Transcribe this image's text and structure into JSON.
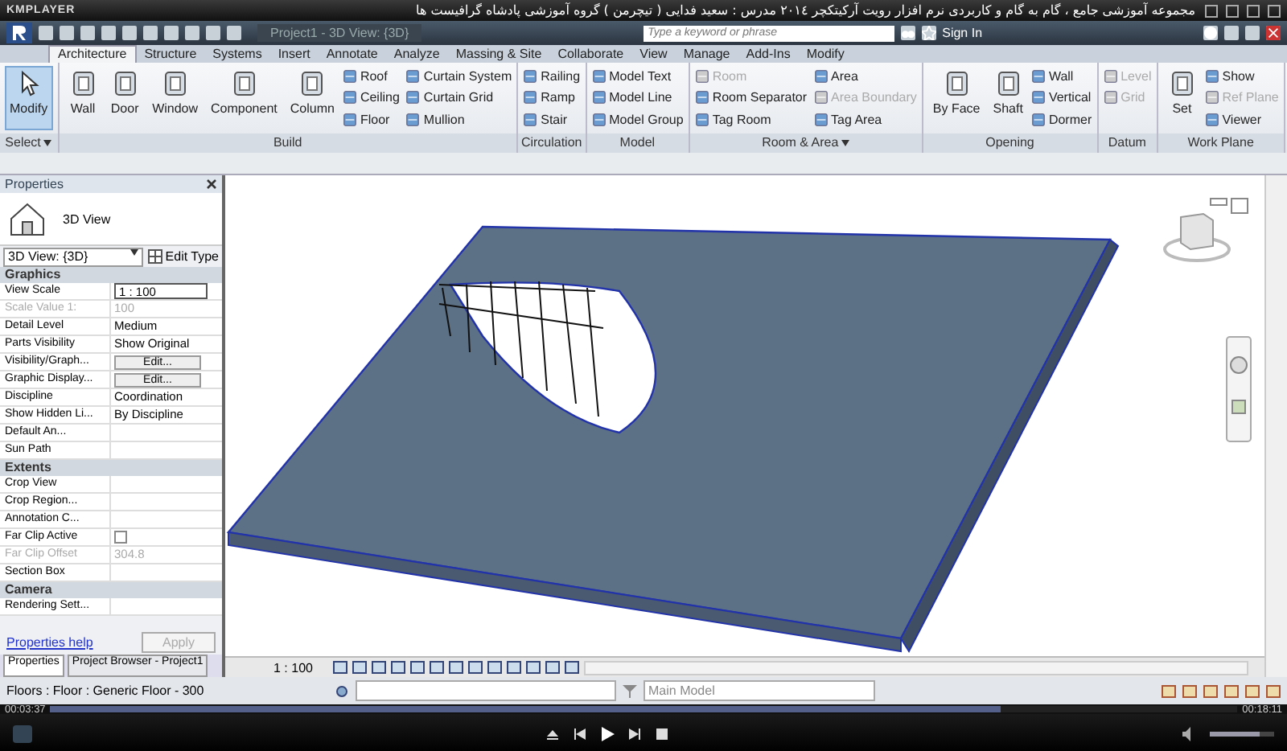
{
  "player": {
    "logo": "KMPLAYER",
    "title": "مجموعه آموزشی جامع ، گام به گام و کاربردی نرم افزار رویت آرکیتکچر ٢٠١٤   مدرس : سعید فدایی ( تیچرمن ) گروه آموزشی پادشاه گرافیست ها"
  },
  "revit": {
    "document_title": "Project1 - 3D View: {3D}",
    "search": {
      "placeholder": "Type a keyword or phrase"
    },
    "sign_in": "Sign In",
    "tabs": [
      {
        "label": "Architecture",
        "selected": true
      },
      {
        "label": "Structure",
        "selected": false
      },
      {
        "label": "Systems",
        "selected": false
      },
      {
        "label": "Insert",
        "selected": false
      },
      {
        "label": "Annotate",
        "selected": false
      },
      {
        "label": "Analyze",
        "selected": false
      },
      {
        "label": "Massing & Site",
        "selected": false
      },
      {
        "label": "Collaborate",
        "selected": false
      },
      {
        "label": "View",
        "selected": false
      },
      {
        "label": "Manage",
        "selected": false
      },
      {
        "label": "Add-Ins",
        "selected": false
      },
      {
        "label": "Modify",
        "selected": false
      }
    ],
    "panels": [
      {
        "label": "Select",
        "dropdown": true,
        "tools": [
          {
            "label": "Modify",
            "kind": "large",
            "disabled": false,
            "selected": true
          }
        ]
      },
      {
        "label": "Build",
        "tools": [
          {
            "label": "Wall",
            "kind": "large",
            "disabled": false,
            "selected": false
          },
          {
            "label": "Door",
            "kind": "large",
            "disabled": false,
            "selected": false
          },
          {
            "label": "Window",
            "kind": "large",
            "disabled": false,
            "selected": false
          },
          {
            "label": "Component",
            "kind": "large",
            "disabled": false,
            "selected": false
          },
          {
            "label": "Column",
            "kind": "large",
            "disabled": false,
            "selected": false
          },
          {
            "label": "Roof",
            "kind": "small",
            "disabled": false,
            "selected": false
          },
          {
            "label": "Ceiling",
            "kind": "small",
            "disabled": false,
            "selected": false
          },
          {
            "label": "Floor",
            "kind": "small",
            "disabled": false,
            "selected": false
          },
          {
            "label": "Curtain System",
            "kind": "small",
            "disabled": false,
            "selected": false
          },
          {
            "label": "Curtain Grid",
            "kind": "small",
            "disabled": false,
            "selected": false
          },
          {
            "label": "Mullion",
            "kind": "small",
            "disabled": false,
            "selected": false
          }
        ]
      },
      {
        "label": "Circulation",
        "tools": [
          {
            "label": "Railing",
            "kind": "small",
            "disabled": false,
            "selected": false
          },
          {
            "label": "Ramp",
            "kind": "small",
            "disabled": false,
            "selected": false
          },
          {
            "label": "Stair",
            "kind": "small",
            "disabled": false,
            "selected": false
          }
        ]
      },
      {
        "label": "Model",
        "tools": [
          {
            "label": "Model Text",
            "kind": "small",
            "disabled": false,
            "selected": false
          },
          {
            "label": "Model Line",
            "kind": "small",
            "disabled": false,
            "selected": false
          },
          {
            "label": "Model Group",
            "kind": "small",
            "disabled": false,
            "selected": false
          }
        ]
      },
      {
        "label": "Room & Area",
        "dropdown": true,
        "tools": [
          {
            "label": "Room",
            "kind": "small",
            "disabled": true,
            "selected": false
          },
          {
            "label": "Room Separator",
            "kind": "small",
            "disabled": false,
            "selected": false
          },
          {
            "label": "Tag Room",
            "kind": "small",
            "disabled": false,
            "selected": false
          },
          {
            "label": "Area",
            "kind": "small",
            "disabled": false,
            "selected": false
          },
          {
            "label": "Area Boundary",
            "kind": "small",
            "disabled": true,
            "selected": false
          },
          {
            "label": "Tag Area",
            "kind": "small",
            "disabled": false,
            "selected": false
          }
        ]
      },
      {
        "label": "Opening",
        "tools": [
          {
            "label": "By Face",
            "kind": "large",
            "disabled": false,
            "selected": false
          },
          {
            "label": "Shaft",
            "kind": "large",
            "disabled": false,
            "selected": false
          },
          {
            "label": "Wall",
            "kind": "small",
            "disabled": false,
            "selected": false
          },
          {
            "label": "Vertical",
            "kind": "small",
            "disabled": false,
            "selected": false
          },
          {
            "label": "Dormer",
            "kind": "small",
            "disabled": false,
            "selected": false
          }
        ]
      },
      {
        "label": "Datum",
        "tools": [
          {
            "label": "Level",
            "kind": "small",
            "disabled": true,
            "selected": false
          },
          {
            "label": "Grid",
            "kind": "small",
            "disabled": true,
            "selected": false
          }
        ]
      },
      {
        "label": "Work Plane",
        "tools": [
          {
            "label": "Set",
            "kind": "large",
            "disabled": false,
            "selected": false
          },
          {
            "label": "Show",
            "kind": "small",
            "disabled": false,
            "selected": false
          },
          {
            "label": "Ref Plane",
            "kind": "small",
            "disabled": true,
            "selected": false
          },
          {
            "label": "Viewer",
            "kind": "small",
            "disabled": false,
            "selected": false
          }
        ]
      }
    ],
    "properties": {
      "title": "Properties",
      "type_name": "3D View",
      "view_selector": "3D View: {3D}",
      "edit_type": "Edit Type",
      "groups": [
        {
          "label": "Graphics",
          "rows": [
            {
              "label": "View Scale",
              "value": "1 : 100",
              "kind": "input",
              "disabled": false
            },
            {
              "label": "Scale Value    1:",
              "value": "100",
              "kind": "text",
              "disabled": true
            },
            {
              "label": "Detail Level",
              "value": "Medium",
              "kind": "text",
              "disabled": false
            },
            {
              "label": "Parts Visibility",
              "value": "Show Original",
              "kind": "text",
              "disabled": false
            },
            {
              "label": "Visibility/Graph...",
              "value": "Edit...",
              "kind": "button",
              "disabled": false
            },
            {
              "label": "Graphic Display...",
              "value": "Edit...",
              "kind": "button",
              "disabled": false
            },
            {
              "label": "Discipline",
              "value": "Coordination",
              "kind": "text",
              "disabled": false
            },
            {
              "label": "Show Hidden Li...",
              "value": "By Discipline",
              "kind": "text",
              "disabled": false
            },
            {
              "label": "Default An...",
              "kind": "text",
              "disabled": false
            },
            {
              "label": "Sun Path",
              "kind": "text",
              "disabled": false
            }
          ]
        },
        {
          "label": "Extents",
          "rows": [
            {
              "label": "Crop View",
              "kind": "text",
              "disabled": false
            },
            {
              "label": "Crop Region...",
              "kind": "text",
              "disabled": false
            },
            {
              "label": "Annotation C...",
              "kind": "text",
              "disabled": false
            },
            {
              "label": "Far Clip Active",
              "kind": "check",
              "checked": false,
              "disabled": false
            },
            {
              "label": "Far Clip Offset",
              "value": "304.8",
              "kind": "text",
              "disabled": true
            },
            {
              "label": "Section Box",
              "kind": "text",
              "disabled": false
            }
          ]
        },
        {
          "label": "Camera",
          "rows": [
            {
              "label": "Rendering Sett...",
              "kind": "text",
              "disabled": false
            }
          ]
        }
      ],
      "help_link": "Properties help",
      "apply": "Apply"
    },
    "bottom_tabs": [
      {
        "label": "Properties",
        "selected": true
      },
      {
        "label": "Project Browser - Project1",
        "selected": false
      }
    ],
    "view_scale": "1 : 100",
    "status_text": "Floors : Floor : Generic Floor - 300",
    "model_selector": "Main Model"
  },
  "playback": {
    "elapsed": "00:03:37",
    "total": "00:18:11",
    "level": 0.8,
    "volume": {
      "level": 0.78
    }
  }
}
